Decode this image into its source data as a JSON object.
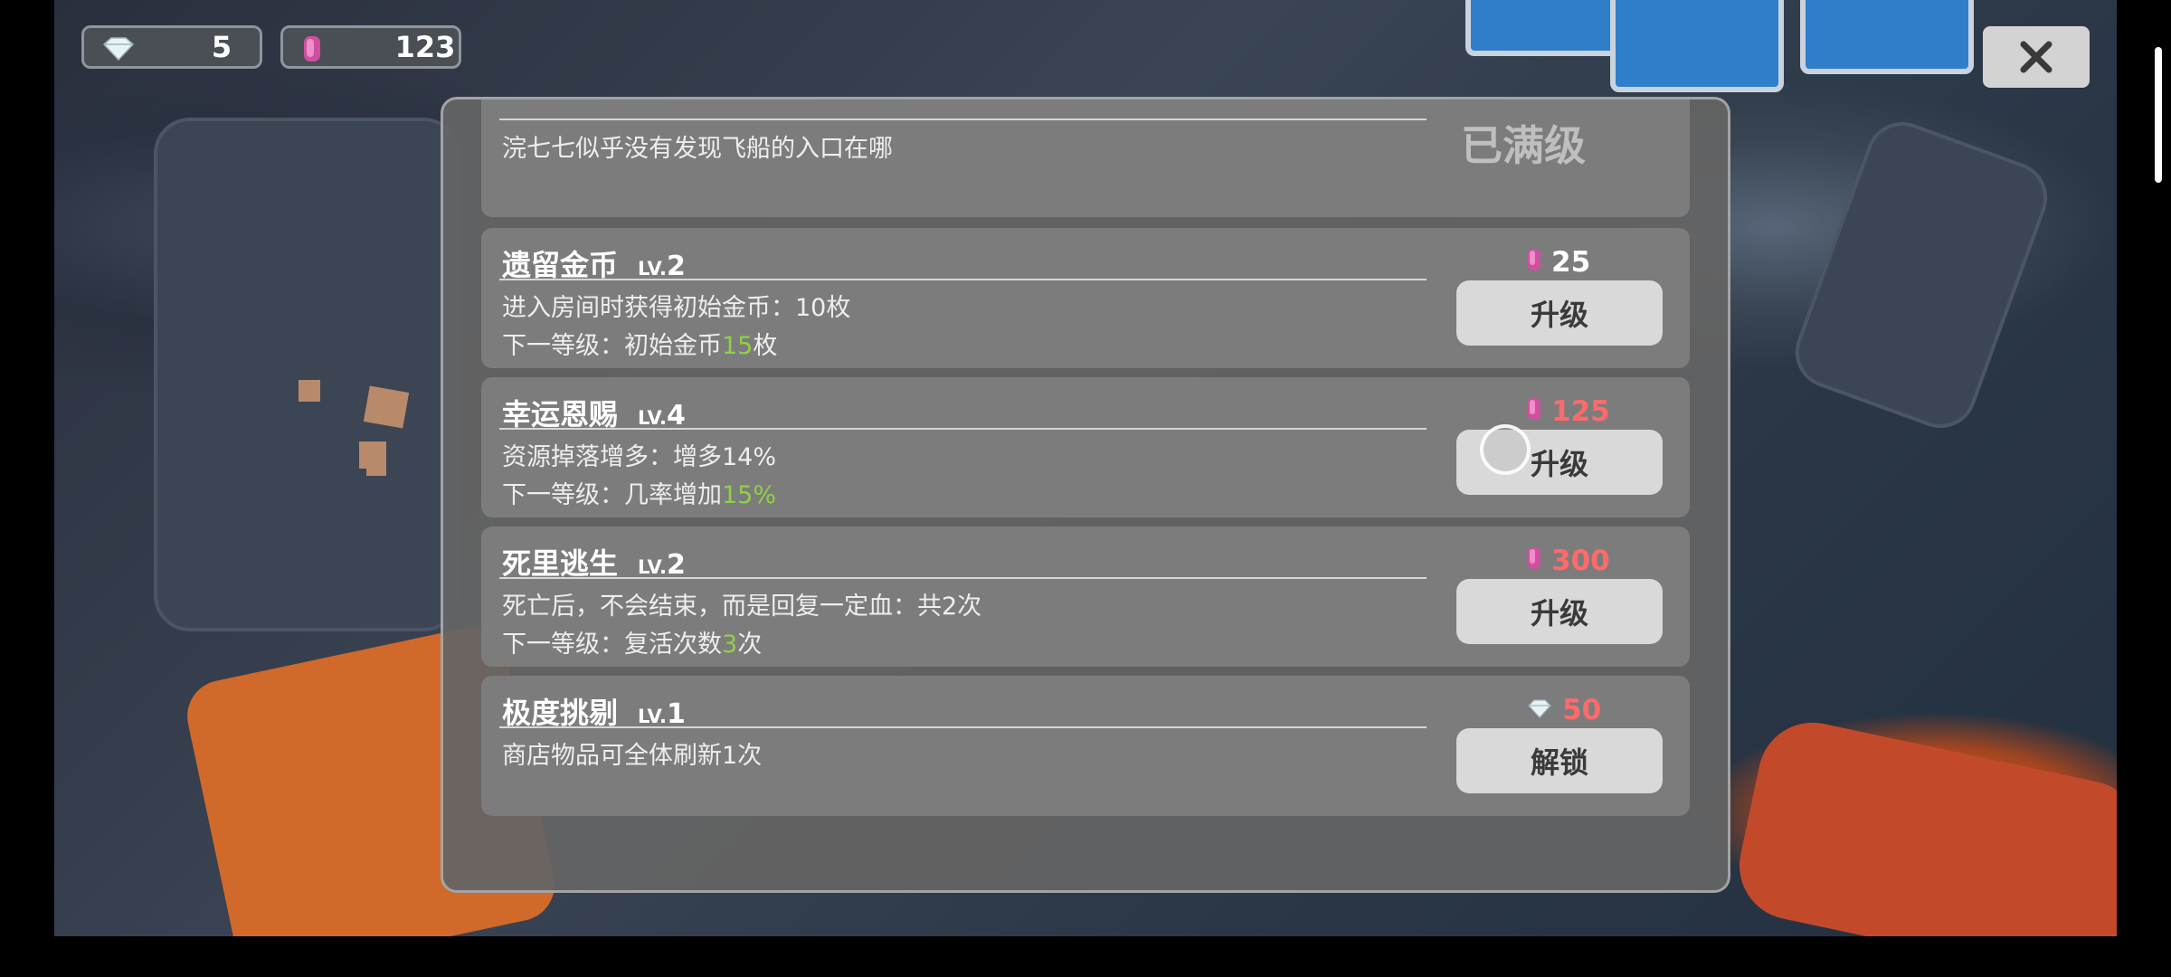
{
  "currencies": {
    "gems": {
      "icon": "gem-icon",
      "value": "5"
    },
    "coins": {
      "icon": "pink-coin-icon",
      "value": "123"
    }
  },
  "close": {
    "icon": "close-icon",
    "label": "×"
  },
  "upgrades": [
    {
      "name": "",
      "level_prefix": "",
      "level": "",
      "desc1": "浣七七似乎没有发现飞船的入口在哪",
      "status": "已满级"
    },
    {
      "name": "遗留金币",
      "level_prefix": "LV.",
      "level": "2",
      "desc1": "进入房间时获得初始金币：10枚",
      "desc2_pre": "下一等级：初始金币",
      "desc2_hl": "15",
      "desc2_post": "枚",
      "price": "25",
      "price_icon": "pink-coin-icon",
      "affordable": true,
      "button": "升级"
    },
    {
      "name": "幸运恩赐",
      "level_prefix": "LV.",
      "level": "4",
      "desc1": "资源掉落增多：增多14%",
      "desc2_pre": "下一等级：几率增加",
      "desc2_hl": "15%",
      "desc2_post": "",
      "price": "125",
      "price_icon": "pink-coin-icon",
      "affordable": false,
      "button": "升级"
    },
    {
      "name": "死里逃生",
      "level_prefix": "LV.",
      "level": "2",
      "desc1": "死亡后，不会结束，而是回复一定血：共2次",
      "desc2_pre": "下一等级：复活次数",
      "desc2_hl": "3",
      "desc2_post": "次",
      "price": "300",
      "price_icon": "pink-coin-icon",
      "affordable": false,
      "button": "升级"
    },
    {
      "name": "极度挑剔",
      "level_prefix": "LV.",
      "level": "1",
      "desc1": "商店物品可全体刷新1次",
      "price": "50",
      "price_icon": "gem-icon",
      "affordable": false,
      "button": "解锁"
    }
  ],
  "colors": {
    "highlight": "#8fd048",
    "insufficient": "#ff6a6a",
    "button_bg": "#d9d9d9"
  }
}
